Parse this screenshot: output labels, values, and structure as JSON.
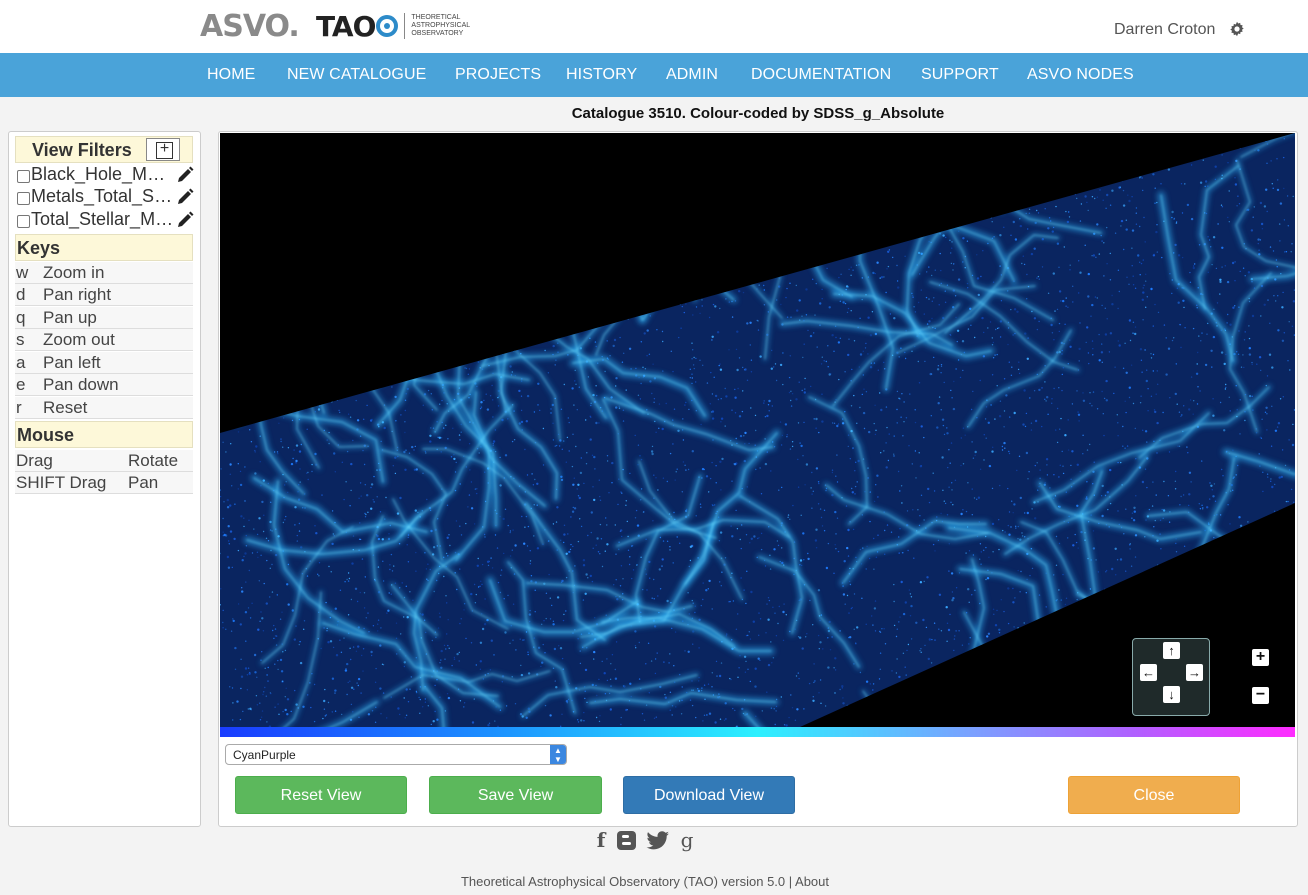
{
  "header": {
    "logo_asvo": "ASVO.",
    "logo_tao": "TAO",
    "logo_tao_sub": [
      "THEORETICAL",
      "ASTROPHYSICAL",
      "OBSERVATORY"
    ],
    "user_name": "Darren Croton",
    "settings_icon": "gear-icon"
  },
  "nav": {
    "items": [
      "HOME",
      "NEW CATALOGUE",
      "PROJECTS",
      "HISTORY",
      "ADMIN",
      "DOCUMENTATION",
      "SUPPORT",
      "ASVO NODES"
    ]
  },
  "sidebar": {
    "view_filters_title": "View Filters",
    "add_label": "+",
    "filters": [
      {
        "label": "Black_Hole_Mass",
        "checked": false
      },
      {
        "label": "Metals_Total_Stellar_Mass",
        "checked": false
      },
      {
        "label": "Total_Stellar_Mass",
        "checked": false
      }
    ],
    "keys_title": "Keys",
    "keys": [
      {
        "key": "w",
        "action": "Zoom in"
      },
      {
        "key": "d",
        "action": "Pan right"
      },
      {
        "key": "q",
        "action": "Pan up"
      },
      {
        "key": "s",
        "action": "Zoom out"
      },
      {
        "key": "a",
        "action": "Pan left"
      },
      {
        "key": "e",
        "action": "Pan down"
      },
      {
        "key": "r",
        "action": "Reset"
      }
    ],
    "mouse_title": "Mouse",
    "mouse": [
      {
        "input": "Drag",
        "action": "Rotate"
      },
      {
        "input": "SHIFT Drag",
        "action": "Pan"
      }
    ]
  },
  "viewer": {
    "title": "Catalogue 3510. Colour-coded by SDSS_g_Absolute",
    "pad": {
      "up": "↑",
      "left": "←",
      "right": "→",
      "down": "↓"
    },
    "zoom_in": "+",
    "zoom_out": "−",
    "colormap_selected": "CyanPurple",
    "colors": {
      "background": "#000000",
      "particles": "#1e7bff",
      "filaments": "#3ed0ff"
    }
  },
  "actions": {
    "reset": "Reset View",
    "save": "Save View",
    "download": "Download View",
    "close": "Close"
  },
  "social": [
    "f",
    "B",
    "twitter-bird",
    "g"
  ],
  "footer": {
    "text": "Theoretical Astrophysical Observatory (TAO) version 5.0 | ",
    "about": "About"
  }
}
